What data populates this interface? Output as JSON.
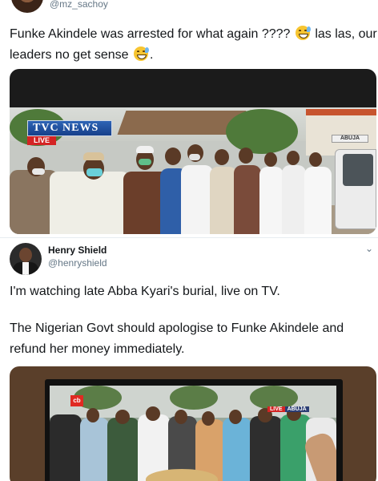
{
  "tweet1": {
    "handle": "@mz_sachoy",
    "text_part1": "Funke Akindele was arrested for what again ???? ",
    "text_part2": " las las, our leaders no get sense ",
    "text_part3": ".",
    "emoji_icon": "grinning-sweat-emoji",
    "media": {
      "logo_text": "TVC NEWS",
      "live_text": "LIVE",
      "sign_text": "ABUJA"
    }
  },
  "tweet2": {
    "author_name": "Henry Shield",
    "handle": "@henryshield",
    "paragraph1": "I'm watching late Abba Kyari's burial, live on TV.",
    "paragraph2": "The Nigerian Govt should apologise to Funke Akindele and refund her money immediately.",
    "media": {
      "logo_text": "cb",
      "live_text": "LIVE",
      "location_text": "ABUJA"
    }
  },
  "colors": {
    "text": "#14171a",
    "secondary": "#657786",
    "tvc_blue": "#17408a",
    "live_red": "#d42424"
  }
}
